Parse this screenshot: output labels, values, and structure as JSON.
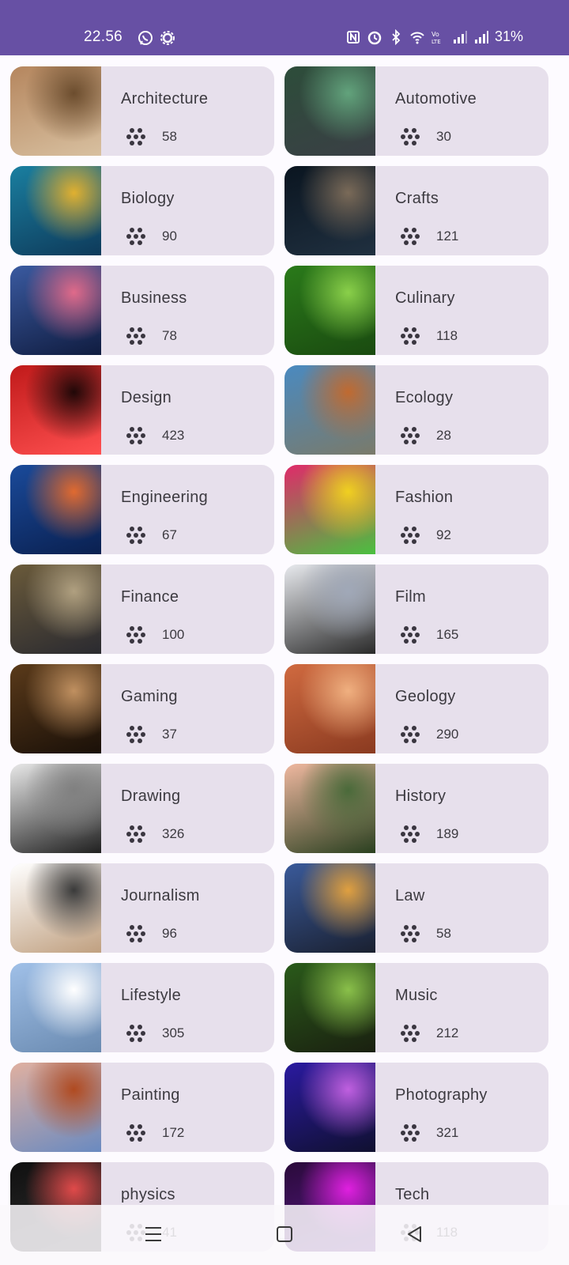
{
  "status_bar": {
    "time": "22.56",
    "battery": "31%",
    "left_icons": [
      "whatsapp-icon",
      "settings-icon"
    ],
    "right_icons": [
      "nfc-icon",
      "alarm-icon",
      "bluetooth-icon",
      "wifi-icon",
      "volte-icon",
      "signal-icon",
      "signal-icon-2"
    ],
    "background_color": "#6750a4"
  },
  "categories": [
    {
      "name": "Architecture",
      "count": "58",
      "colors": [
        "#b5865e",
        "#6c4d2e",
        "#d8c0a0"
      ]
    },
    {
      "name": "Automotive",
      "count": "30",
      "colors": [
        "#2d4d3a",
        "#62a37c",
        "#3a3f45"
      ]
    },
    {
      "name": "Biology",
      "count": "90",
      "colors": [
        "#1a7fa0",
        "#e0b030",
        "#0e3a5a"
      ]
    },
    {
      "name": "Crafts",
      "count": "121",
      "colors": [
        "#0a1520",
        "#7a6a58",
        "#203040"
      ]
    },
    {
      "name": "Business",
      "count": "78",
      "colors": [
        "#3a5aa0",
        "#e06a8a",
        "#101c40"
      ]
    },
    {
      "name": "Culinary",
      "count": "118",
      "colors": [
        "#2a7a1a",
        "#8ad04a",
        "#1a4a10"
      ]
    },
    {
      "name": "Design",
      "count": "423",
      "colors": [
        "#c01a1a",
        "#200808",
        "#ff5050"
      ]
    },
    {
      "name": "Ecology",
      "count": "28",
      "colors": [
        "#4a8ac0",
        "#c06a30",
        "#7a7a6a"
      ]
    },
    {
      "name": "Engineering",
      "count": "67",
      "colors": [
        "#1a4a9a",
        "#e06a30",
        "#0a2050"
      ]
    },
    {
      "name": "Fashion",
      "count": "92",
      "colors": [
        "#e02a6a",
        "#f0d020",
        "#4ac040"
      ]
    },
    {
      "name": "Finance",
      "count": "100",
      "colors": [
        "#6a5a3a",
        "#b0a080",
        "#2a2a30"
      ]
    },
    {
      "name": "Film",
      "count": "165",
      "colors": [
        "#e8eaee",
        "#a0a8b8",
        "#2a2a2a"
      ]
    },
    {
      "name": "Gaming",
      "count": "37",
      "colors": [
        "#5a3a1a",
        "#c09060",
        "#1a1008"
      ]
    },
    {
      "name": "Geology",
      "count": "290",
      "colors": [
        "#d06a40",
        "#f0b080",
        "#8a3a20"
      ]
    },
    {
      "name": "Drawing",
      "count": "326",
      "colors": [
        "#e8e8e8",
        "#808080",
        "#202020"
      ]
    },
    {
      "name": "History",
      "count": "189",
      "colors": [
        "#f0b8a0",
        "#4a6a3a",
        "#2a4020"
      ]
    },
    {
      "name": "Journalism",
      "count": "96",
      "colors": [
        "#ffffff",
        "#3a3a3a",
        "#c0a080"
      ]
    },
    {
      "name": "Law",
      "count": "58",
      "colors": [
        "#3a5a9a",
        "#e0a040",
        "#1a2030"
      ]
    },
    {
      "name": "Lifestyle",
      "count": "305",
      "colors": [
        "#a0c0e8",
        "#ffffff",
        "#6a8ab0"
      ]
    },
    {
      "name": "Music",
      "count": "212",
      "colors": [
        "#2a5a1a",
        "#8ac04a",
        "#1a2010"
      ]
    },
    {
      "name": "Painting",
      "count": "172",
      "colors": [
        "#e0b0a0",
        "#b04a20",
        "#6a8ac0"
      ]
    },
    {
      "name": "Photography",
      "count": "321",
      "colors": [
        "#2a1aa0",
        "#c060e0",
        "#101030"
      ]
    },
    {
      "name": "physics",
      "count": "41",
      "colors": [
        "#101010",
        "#e04a4a",
        "#303030"
      ]
    },
    {
      "name": "Tech",
      "count": "118",
      "colors": [
        "#2a0a3a",
        "#e020e0",
        "#5a1a8a"
      ]
    }
  ],
  "nav_bar": {
    "items": [
      "menu-icon",
      "home-icon",
      "back-icon"
    ]
  }
}
